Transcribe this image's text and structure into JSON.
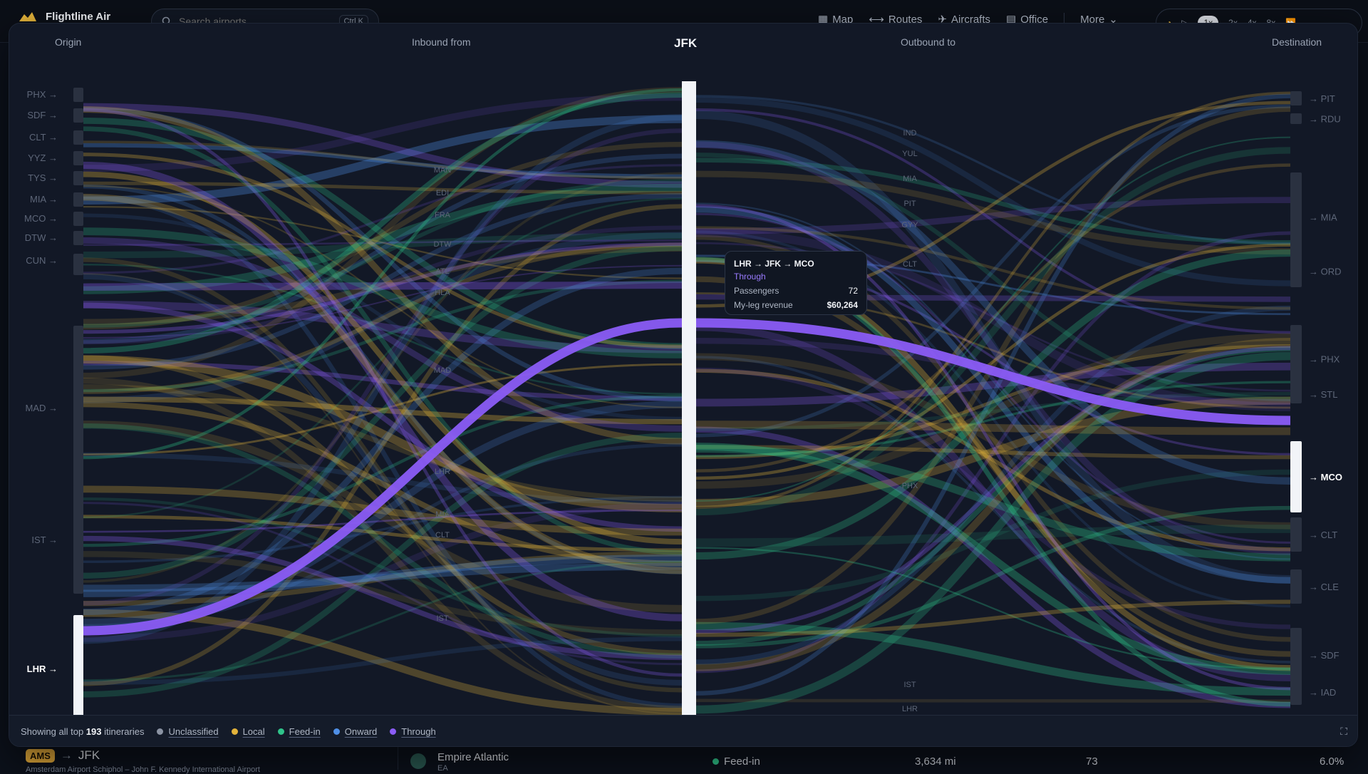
{
  "app": {
    "name": "Flightline Air"
  },
  "search": {
    "placeholder": "Search airports",
    "shortcut": "Ctrl K"
  },
  "nav": {
    "items": [
      {
        "label": "Map",
        "icon": "map-icon"
      },
      {
        "label": "Routes",
        "icon": "routes-icon"
      },
      {
        "label": "Aircrafts",
        "icon": "plane-icon"
      },
      {
        "label": "Office",
        "icon": "office-icon"
      },
      {
        "label": "More",
        "icon": "chevron-down-icon"
      }
    ]
  },
  "speed": {
    "options": [
      "1x",
      "2x",
      "4x",
      "8x"
    ],
    "active": "1x"
  },
  "headers": {
    "origin": "Origin",
    "inbound": "Inbound from",
    "hub": "JFK",
    "outbound": "Outbound to",
    "destination": "Destination"
  },
  "origins": [
    "PHX",
    "SDF",
    "CLT",
    "YYZ",
    "TYS",
    "MIA",
    "MCO",
    "DTW",
    "CUN",
    "MAD",
    "IST",
    "LHR"
  ],
  "inbound": [
    "MAN",
    "EDI",
    "FRA",
    "DTW",
    "ATL",
    "HLA",
    "MAD",
    "LHR",
    "MIA",
    "CLT",
    "IST"
  ],
  "outbound": [
    "IND",
    "YUL",
    "MIA",
    "PIT",
    "GYY",
    "CLT",
    "PHX",
    "IST",
    "LHR"
  ],
  "destinations": [
    "PIT",
    "RDU",
    "MIA",
    "ORD",
    "PHX",
    "STL",
    "MCO",
    "CLT",
    "CLE",
    "SDF",
    "IAD"
  ],
  "highlight": {
    "origin": "LHR",
    "destination": "MCO"
  },
  "tooltip": {
    "route": "LHR → JFK → MCO",
    "kind": "Through",
    "passengers_label": "Passengers",
    "passengers": "72",
    "revenue_label": "My-leg revenue",
    "revenue": "$60,264"
  },
  "footer": {
    "prefix": "Showing all top",
    "count": "193",
    "suffix": "itineraries",
    "legend": [
      {
        "label": "Unclassified",
        "color": "#8b93a3"
      },
      {
        "label": "Local",
        "color": "#e2b23a"
      },
      {
        "label": "Feed-in",
        "color": "#2fc48a"
      },
      {
        "label": "Onward",
        "color": "#4f8fe6"
      },
      {
        "label": "Through",
        "color": "#8b5cf6"
      }
    ]
  },
  "table_row": {
    "origin_code": "AMS",
    "dest_code": "JFK",
    "subtitle": "Amsterdam Airport Schiphol – John F. Kennedy International Airport",
    "airline": "Empire Atlantic",
    "airline_code": "EA",
    "type": "Feed-in",
    "distance": "3,634 mi",
    "passengers": "73",
    "share": "6.0%"
  }
}
